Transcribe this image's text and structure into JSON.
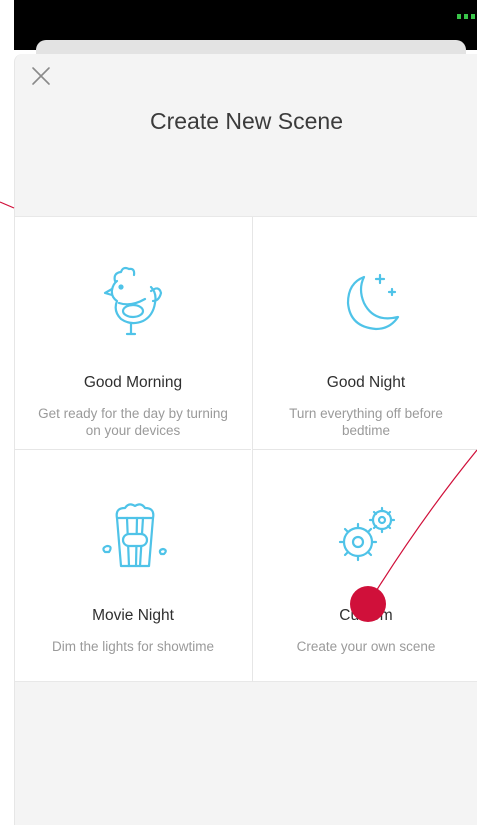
{
  "screen": {
    "title": "Create New Scene",
    "close_icon": "close-icon"
  },
  "scenes": [
    {
      "name": "Good Morning",
      "description": "Get ready for the day by turning on your devices",
      "icon": "rooster-icon"
    },
    {
      "name": "Good Night",
      "description": "Turn everything off before bedtime",
      "icon": "moon-stars-icon"
    },
    {
      "name": "Movie Night",
      "description": "Dim the lights for showtime",
      "icon": "popcorn-icon"
    },
    {
      "name": "Custom",
      "description": "Create your own scene",
      "icon": "gears-icon"
    }
  ],
  "colors": {
    "accent": "#4fc3e8",
    "pointer": "#d0103a",
    "sheet_background": "#f4f4f4"
  }
}
